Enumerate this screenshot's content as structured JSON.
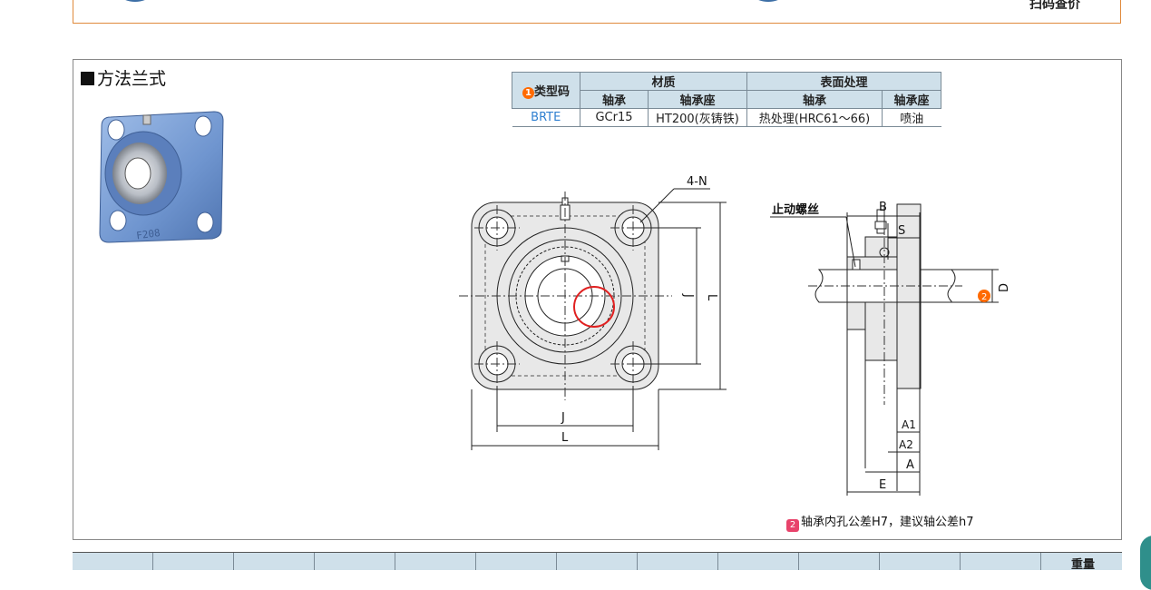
{
  "top": {
    "scan_price": "扫码查价"
  },
  "section": {
    "title": "方法兰式"
  },
  "spec_table": {
    "type_code_header": "类型码",
    "type_code_number": "1",
    "material_header": "材质",
    "surface_header": "表面处理",
    "sub_headers": [
      "轴承",
      "轴承座",
      "轴承",
      "轴承座"
    ],
    "row": {
      "type": "BRTE",
      "bearing_material": "GCr15",
      "housing_material": "HT200(灰铸铁)",
      "bearing_surface": "热处理(HRC61～66)",
      "housing_surface": "喷油"
    }
  },
  "drawing_labels": {
    "holes": "4-N",
    "J_vertical": "J",
    "L_vertical": "L",
    "J_horizontal": "J",
    "L_horizontal": "L",
    "set_screw": "止动螺丝",
    "B": "B",
    "S": "S",
    "D": "D",
    "D_number": "2",
    "A1": "A1",
    "A2": "A2",
    "A": "A",
    "E": "E"
  },
  "note": {
    "icon": "2",
    "text": "轴承内孔公差H7，建议轴公差h7"
  },
  "bottom": {
    "weight_label": "重量"
  },
  "colors": {
    "accent_orange": "#ff6a00",
    "header_blue": "#cfe0ea",
    "type_blue": "#2f7fd0",
    "note_pink": "#e8436b",
    "panel_border": "#888888",
    "top_border": "#e08a3c"
  }
}
